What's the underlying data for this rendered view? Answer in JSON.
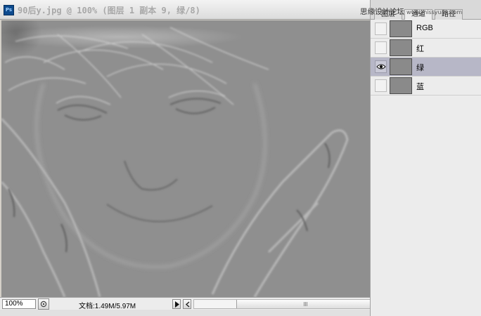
{
  "window": {
    "app_icon": "Ps",
    "title": "90后y.jpg @ 100% (图层 1 副本 9, 绿/8)"
  },
  "statusbar": {
    "zoom": "100%",
    "doc_size": "文档:1.49M/5.97M",
    "scroll_thumb_grip": "|||"
  },
  "panel": {
    "watermark": "思缘设计论坛",
    "watermark_site": "www.missyuan.com",
    "tabs": [
      {
        "label": "图层"
      },
      {
        "label": "通道"
      },
      {
        "label": "路径"
      }
    ],
    "channels": [
      {
        "label": "RGB",
        "visible": false,
        "selected": false
      },
      {
        "label": "红",
        "visible": false,
        "selected": false
      },
      {
        "label": "绿",
        "visible": true,
        "selected": true
      },
      {
        "label": "蓝",
        "visible": false,
        "selected": false
      }
    ]
  },
  "colors": {
    "canvas_gray": "#8f8f8f",
    "selected_row": "#b7b7c7",
    "title_text": "#a8a8a8"
  }
}
